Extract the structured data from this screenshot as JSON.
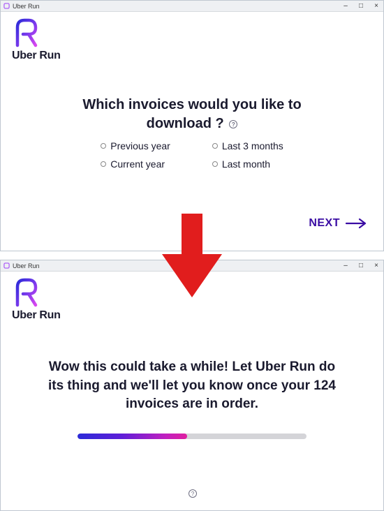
{
  "app": {
    "title": "Uber Run",
    "brand": "Uber Run"
  },
  "titlebar": {
    "minimize": "–",
    "maximize": "□",
    "close": "×"
  },
  "screen1": {
    "headline_line1": "Which invoices would you like to",
    "headline_line2": "download ?",
    "options": [
      "Previous year",
      "Current year",
      "Last 3 months",
      "Last month"
    ],
    "next_label": "NEXT"
  },
  "screen2": {
    "message": "Wow this could take a while! Let Uber Run do its thing and we'll let you know once your 124 invoices are in order.",
    "invoice_count": 124,
    "progress_percent": 48
  },
  "icons": {
    "help": "?",
    "app_icon": "R"
  },
  "colors": {
    "brand_purple": "#5b21b6",
    "brand_magenta": "#c026d3",
    "brand_blue": "#2b2bd8",
    "text_dark": "#1a1a2e",
    "arrow_red": "#e11d1d"
  }
}
